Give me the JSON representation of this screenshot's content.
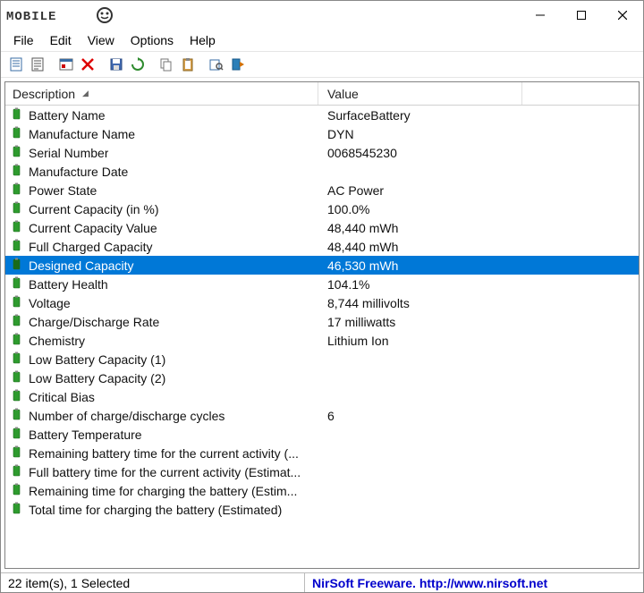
{
  "window": {
    "title_logo_text": "MOBILE"
  },
  "menubar": {
    "items": [
      "File",
      "Edit",
      "View",
      "Options",
      "Help"
    ]
  },
  "toolbar": {
    "icons": [
      "properties-icon",
      "report-icon",
      "sep",
      "options-icon",
      "delete-icon",
      "sep",
      "save-icon",
      "refresh-icon",
      "sep",
      "copy-icon",
      "paste-icon",
      "sep",
      "find-icon",
      "exit-icon"
    ]
  },
  "columns": {
    "description": "Description",
    "value": "Value"
  },
  "rows": [
    {
      "desc": "Battery Name",
      "value": "SurfaceBattery",
      "selected": false
    },
    {
      "desc": "Manufacture Name",
      "value": "DYN",
      "selected": false
    },
    {
      "desc": "Serial Number",
      "value": "0068545230",
      "selected": false
    },
    {
      "desc": "Manufacture Date",
      "value": "",
      "selected": false
    },
    {
      "desc": "Power State",
      "value": "AC Power",
      "selected": false
    },
    {
      "desc": "Current Capacity (in %)",
      "value": "100.0%",
      "selected": false
    },
    {
      "desc": "Current Capacity Value",
      "value": "48,440 mWh",
      "selected": false
    },
    {
      "desc": "Full Charged Capacity",
      "value": "48,440 mWh",
      "selected": false
    },
    {
      "desc": "Designed Capacity",
      "value": "46,530 mWh",
      "selected": true
    },
    {
      "desc": "Battery Health",
      "value": "104.1%",
      "selected": false
    },
    {
      "desc": "Voltage",
      "value": "8,744 millivolts",
      "selected": false
    },
    {
      "desc": "Charge/Discharge Rate",
      "value": "17 milliwatts",
      "selected": false
    },
    {
      "desc": "Chemistry",
      "value": "Lithium Ion",
      "selected": false
    },
    {
      "desc": "Low Battery Capacity (1)",
      "value": "",
      "selected": false
    },
    {
      "desc": "Low Battery Capacity (2)",
      "value": "",
      "selected": false
    },
    {
      "desc": "Critical Bias",
      "value": "",
      "selected": false
    },
    {
      "desc": "Number of charge/discharge cycles",
      "value": "6",
      "selected": false
    },
    {
      "desc": "Battery Temperature",
      "value": "",
      "selected": false
    },
    {
      "desc": "Remaining battery time for the current activity (...",
      "value": "",
      "selected": false
    },
    {
      "desc": "Full battery time for the current activity (Estimat...",
      "value": "",
      "selected": false
    },
    {
      "desc": "Remaining time for charging the battery (Estim...",
      "value": "",
      "selected": false
    },
    {
      "desc": "Total  time for charging the battery (Estimated)",
      "value": "",
      "selected": false
    }
  ],
  "statusbar": {
    "left": "22 item(s), 1 Selected",
    "right": "NirSoft Freeware.  http://www.nirsoft.net"
  }
}
